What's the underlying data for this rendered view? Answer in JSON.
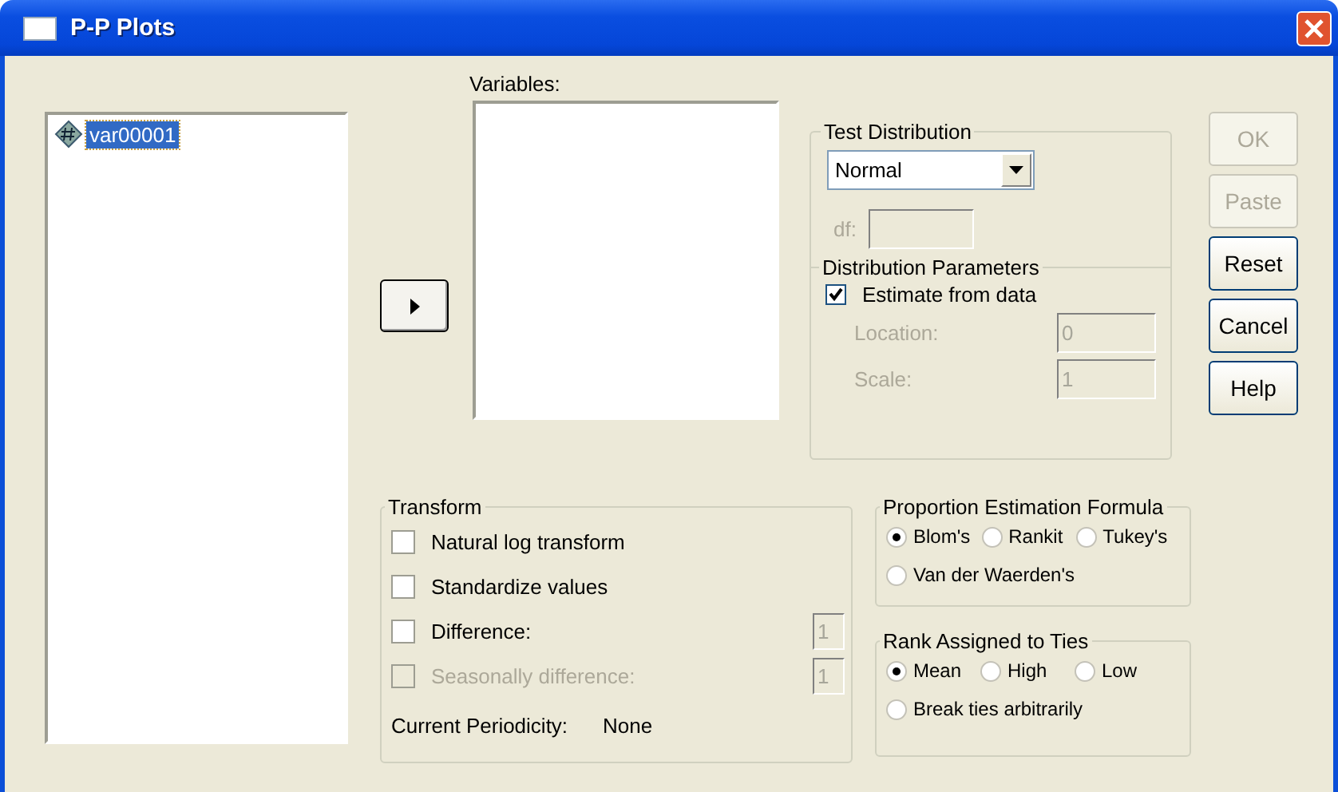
{
  "window": {
    "title": "P-P Plots"
  },
  "source_list": {
    "items": [
      {
        "label": "var00001",
        "selected": true
      }
    ]
  },
  "variables": {
    "label": "Variables:"
  },
  "test_distribution": {
    "title": "Test Distribution",
    "value": "Normal",
    "df": {
      "label": "df:",
      "disabled": true
    }
  },
  "distribution_parameters": {
    "title": "Distribution Parameters",
    "estimate": {
      "label": "Estimate from data",
      "checked": true
    },
    "fields": [
      {
        "label": "Location:",
        "value": "0",
        "disabled": true
      },
      {
        "label": "Scale:",
        "value": "1",
        "disabled": true
      }
    ]
  },
  "buttons": [
    {
      "label": "OK",
      "disabled": true
    },
    {
      "label": "Paste",
      "disabled": true
    },
    {
      "label": "Reset",
      "disabled": false
    },
    {
      "label": "Cancel",
      "disabled": false
    },
    {
      "label": "Help",
      "disabled": false
    }
  ],
  "transform": {
    "title": "Transform",
    "options": [
      {
        "label": "Natural log transform",
        "checked": false,
        "disabled": false
      },
      {
        "label": "Standardize values",
        "checked": false,
        "disabled": false
      },
      {
        "label": "Difference:",
        "checked": false,
        "disabled": false,
        "value": "1"
      },
      {
        "label": "Seasonally difference:",
        "checked": false,
        "disabled": true,
        "value": "1"
      }
    ],
    "periodicity": {
      "label": "Current Periodicity:",
      "value": "None"
    }
  },
  "proportion_formula": {
    "title": "Proportion Estimation Formula",
    "options": [
      {
        "label": "Blom's",
        "selected": true
      },
      {
        "label": "Rankit",
        "selected": false
      },
      {
        "label": "Tukey's",
        "selected": false
      },
      {
        "label": "Van der Waerden's",
        "selected": false
      }
    ]
  },
  "rank_ties": {
    "title": "Rank Assigned to Ties",
    "options": [
      {
        "label": "Mean",
        "selected": true
      },
      {
        "label": "High",
        "selected": false
      },
      {
        "label": "Low",
        "selected": false
      },
      {
        "label": "Break ties arbitrarily",
        "selected": false
      }
    ]
  }
}
